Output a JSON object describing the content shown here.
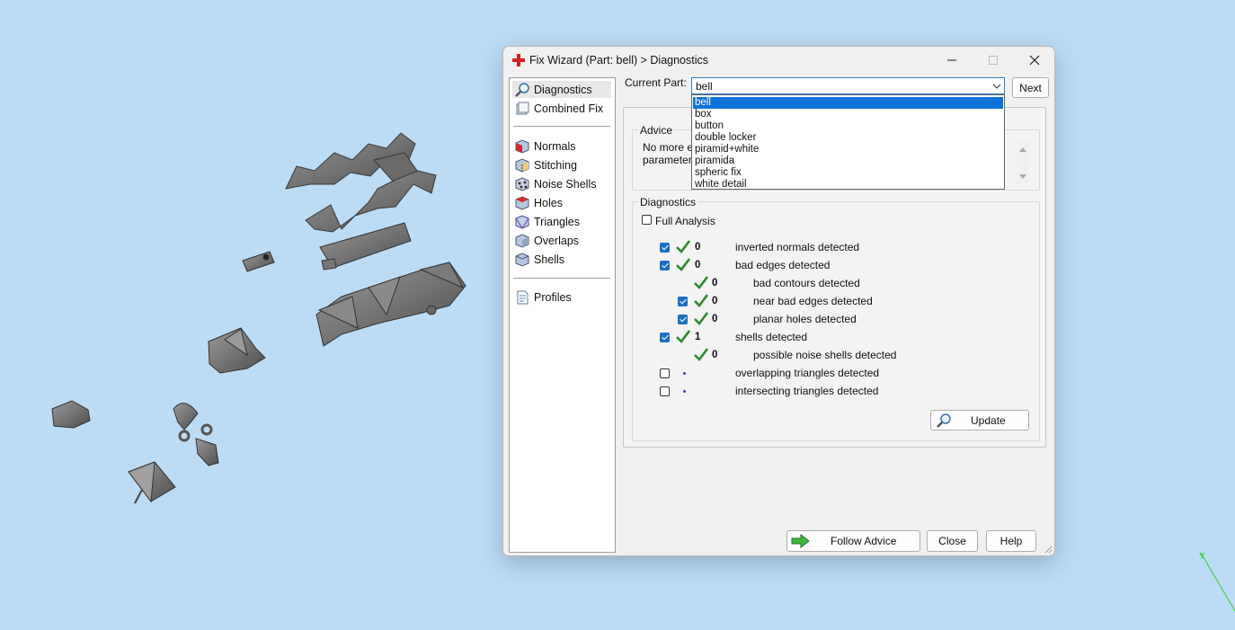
{
  "window": {
    "title": "Fix Wizard (Part: bell) > Diagnostics"
  },
  "sidebar": {
    "items": [
      {
        "label": "Diagnostics",
        "icon": "magnifier-icon"
      },
      {
        "label": "Combined Fix",
        "icon": "combined-fix-icon"
      },
      {
        "label": "Normals",
        "icon": "normals-cube-icon"
      },
      {
        "label": "Stitching",
        "icon": "stitching-cube-icon"
      },
      {
        "label": "Noise Shells",
        "icon": "noise-shells-cube-icon"
      },
      {
        "label": "Holes",
        "icon": "holes-cube-icon"
      },
      {
        "label": "Triangles",
        "icon": "triangles-cube-icon"
      },
      {
        "label": "Overlaps",
        "icon": "overlaps-cube-icon"
      },
      {
        "label": "Shells",
        "icon": "shells-cube-icon"
      },
      {
        "label": "Profiles",
        "icon": "profiles-document-icon"
      }
    ]
  },
  "current_part": {
    "label": "Current Part:",
    "value": "bell",
    "next_label": "Next",
    "options": [
      "bell",
      "box",
      "button",
      "double locker",
      "piramid+white",
      "piramida",
      "spheric fix",
      "white detail"
    ]
  },
  "advice": {
    "title": "Advice",
    "line1": "No more e",
    "line2": "parameters"
  },
  "diagnostics": {
    "title": "Diagnostics",
    "full_analysis_label": "Full Analysis",
    "rows": [
      {
        "checkbox": true,
        "checked": true,
        "status": "ok",
        "count": "0",
        "text": "inverted normals detected"
      },
      {
        "checkbox": true,
        "checked": true,
        "status": "ok",
        "count": "0",
        "text": "bad edges detected"
      },
      {
        "checkbox": false,
        "checked": false,
        "status": "ok",
        "count": "0",
        "text": "bad contours detected"
      },
      {
        "checkbox": true,
        "checked": true,
        "status": "ok",
        "count": "0",
        "text": "near bad edges detected"
      },
      {
        "checkbox": true,
        "checked": true,
        "status": "ok",
        "count": "0",
        "text": "planar holes detected"
      },
      {
        "checkbox": true,
        "checked": true,
        "status": "ok",
        "count": "1",
        "text": "shells detected"
      },
      {
        "checkbox": false,
        "checked": false,
        "status": "ok",
        "count": "0",
        "text": "possible noise shells detected"
      },
      {
        "checkbox": true,
        "checked": false,
        "status": "pending",
        "count": "",
        "text": "overlapping triangles detected"
      },
      {
        "checkbox": true,
        "checked": false,
        "status": "pending",
        "count": "",
        "text": "intersecting triangles detected"
      }
    ],
    "update_label": "Update"
  },
  "footer": {
    "follow_advice_label": "Follow Advice",
    "close_label": "Close",
    "help_label": "Help"
  },
  "colors": {
    "viewport_background": "#bcdcf6",
    "accent": "#0a73d7",
    "ok_tick": "#2f8a2f",
    "title_icon": "#d62020"
  }
}
